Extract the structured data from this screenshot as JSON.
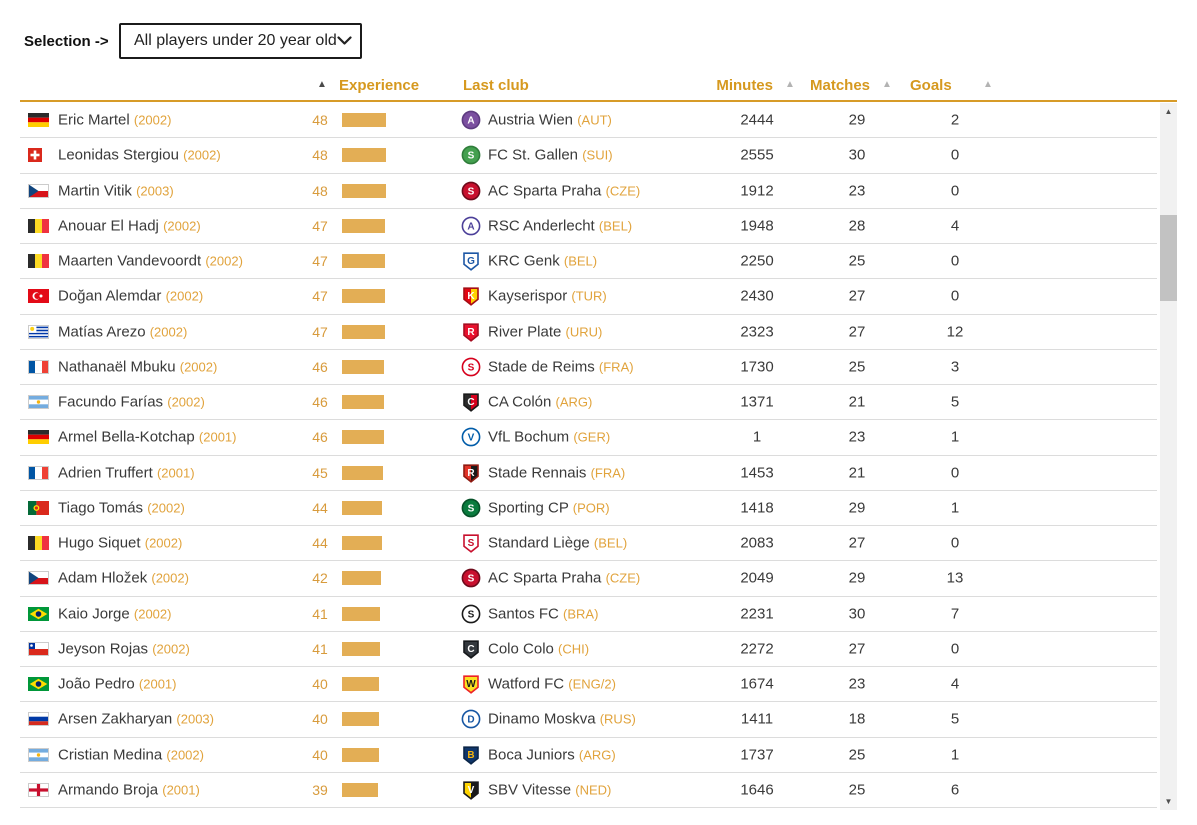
{
  "selection": {
    "label": "Selection ->",
    "value": "All players under 20 year old"
  },
  "columns": {
    "experience": "Experience",
    "last_club": "Last club",
    "minutes": "Minutes",
    "matches": "Matches",
    "goals": "Goals"
  },
  "icons": {
    "sort_asc": "▲",
    "scroll_up": "▲",
    "scroll_down": "▼"
  },
  "colors": {
    "header_gold": "#d6991f",
    "underline_gold": "#d79b28",
    "bar_gold": "#e3ae55",
    "orange_secondary": "#e1a33c",
    "dark_text": "#3a3a3a",
    "row_border": "#dcdcdc",
    "sort_arrow_grey": "#b3b3b3",
    "sort_arrow_dark": "#4a4a4a",
    "scroll_track": "#f1f1f1",
    "scroll_thumb": "#c2c2c2"
  },
  "experience_max": 48,
  "players": [
    {
      "name": "Eric Martel",
      "year": "(2002)",
      "nat": "DE",
      "exp": 48,
      "club": "Austria Wien",
      "cc": "(AUT)",
      "logo": {
        "shape": "circle",
        "c1": "#7b4fa0",
        "border": "#5d3b80",
        "letter": "A",
        "lc": "#ffffff"
      },
      "minutes": 2444,
      "matches": 29,
      "goals": 2
    },
    {
      "name": "Leonidas Stergiou",
      "year": "(2002)",
      "nat": "CH",
      "exp": 48,
      "club": "FC St. Gallen",
      "cc": "(SUI)",
      "logo": {
        "shape": "circle",
        "c1": "#44a04f",
        "border": "#2f7d3a",
        "letter": "S",
        "lc": "#ffffff"
      },
      "minutes": 2555,
      "matches": 30,
      "goals": 0
    },
    {
      "name": "Martin Vitik",
      "year": "(2003)",
      "nat": "CZ",
      "exp": 48,
      "club": "AC Sparta Praha",
      "cc": "(CZE)",
      "logo": {
        "shape": "circle",
        "c1": "#c8102e",
        "border": "#6e0a1b",
        "letter": "S",
        "lc": "#ffffff"
      },
      "minutes": 1912,
      "matches": 23,
      "goals": 0
    },
    {
      "name": "Anouar El Hadj",
      "year": "(2002)",
      "nat": "BE",
      "exp": 47,
      "club": "RSC Anderlecht",
      "cc": "(BEL)",
      "logo": {
        "shape": "circle",
        "c1": "#ffffff",
        "border": "#4b3f99",
        "letter": "A",
        "lc": "#4b3f99"
      },
      "minutes": 1948,
      "matches": 28,
      "goals": 4
    },
    {
      "name": "Maarten Vandevoordt",
      "year": "(2002)",
      "nat": "BE",
      "exp": 47,
      "club": "KRC Genk",
      "cc": "(BEL)",
      "logo": {
        "shape": "shield",
        "c1": "#ffffff",
        "border": "#1d57a5",
        "letter": "G",
        "lc": "#1d57a5"
      },
      "minutes": 2250,
      "matches": 25,
      "goals": 0
    },
    {
      "name": "Doğan Alemdar",
      "year": "(2002)",
      "nat": "TR",
      "exp": 47,
      "club": "Kayserispor",
      "cc": "(TUR)",
      "logo": {
        "shape": "shield",
        "c1": "#e30613",
        "c2": "#ffd200",
        "border": "#a50d14",
        "letter": "K",
        "lc": "#ffffff"
      },
      "minutes": 2430,
      "matches": 27,
      "goals": 0
    },
    {
      "name": "Matías Arezo",
      "year": "(2002)",
      "nat": "UY",
      "exp": 47,
      "club": "River Plate",
      "cc": "(URU)",
      "logo": {
        "shape": "shield",
        "c1": "#e8112d",
        "border": "#a50d21",
        "letter": "R",
        "lc": "#ffffff"
      },
      "minutes": 2323,
      "matches": 27,
      "goals": 12
    },
    {
      "name": "Nathanaël Mbuku",
      "year": "(2002)",
      "nat": "FR",
      "exp": 46,
      "club": "Stade de Reims",
      "cc": "(FRA)",
      "logo": {
        "shape": "circle",
        "c1": "#ffffff",
        "border": "#d6001c",
        "letter": "S",
        "lc": "#d6001c"
      },
      "minutes": 1730,
      "matches": 25,
      "goals": 3
    },
    {
      "name": "Facundo Farías",
      "year": "(2002)",
      "nat": "AR",
      "exp": 46,
      "club": "CA Colón",
      "cc": "(ARG)",
      "logo": {
        "shape": "shield",
        "c1": "#2b2b2b",
        "c2": "#d6001c",
        "border": "#1a1a1a",
        "letter": "C",
        "lc": "#ffffff"
      },
      "minutes": 1371,
      "matches": 21,
      "goals": 5
    },
    {
      "name": "Armel Bella-Kotchap",
      "year": "(2001)",
      "nat": "DE",
      "exp": 46,
      "club": "VfL Bochum",
      "cc": "(GER)",
      "logo": {
        "shape": "circle",
        "c1": "#ffffff",
        "border": "#005ca9",
        "letter": "V",
        "lc": "#005ca9"
      },
      "minutes": 1,
      "matches": 23,
      "goals": 1
    },
    {
      "name": "Adrien Truffert",
      "year": "(2001)",
      "nat": "FR",
      "exp": 45,
      "club": "Stade Rennais",
      "cc": "(FRA)",
      "logo": {
        "shape": "shield",
        "c1": "#e13327",
        "c2": "#1a1a1a",
        "border": "#8f1b12",
        "letter": "R",
        "lc": "#ffffff"
      },
      "minutes": 1453,
      "matches": 21,
      "goals": 0
    },
    {
      "name": "Tiago Tomás",
      "year": "(2002)",
      "nat": "PT",
      "exp": 44,
      "club": "Sporting CP",
      "cc": "(POR)",
      "logo": {
        "shape": "circle",
        "c1": "#0a7b3e",
        "border": "#065128",
        "letter": "S",
        "lc": "#ffffff"
      },
      "minutes": 1418,
      "matches": 29,
      "goals": 1
    },
    {
      "name": "Hugo Siquet",
      "year": "(2002)",
      "nat": "BE",
      "exp": 44,
      "club": "Standard Liège",
      "cc": "(BEL)",
      "logo": {
        "shape": "shield",
        "c1": "#ffffff",
        "border": "#c8102e",
        "letter": "S",
        "lc": "#c8102e"
      },
      "minutes": 2083,
      "matches": 27,
      "goals": 0
    },
    {
      "name": "Adam Hložek",
      "year": "(2002)",
      "nat": "CZ",
      "exp": 42,
      "club": "AC Sparta Praha",
      "cc": "(CZE)",
      "logo": {
        "shape": "circle",
        "c1": "#c8102e",
        "border": "#6e0a1b",
        "letter": "S",
        "lc": "#ffffff"
      },
      "minutes": 2049,
      "matches": 29,
      "goals": 13
    },
    {
      "name": "Kaio Jorge",
      "year": "(2002)",
      "nat": "BR",
      "exp": 41,
      "club": "Santos FC",
      "cc": "(BRA)",
      "logo": {
        "shape": "circle",
        "c1": "#ffffff",
        "border": "#1a1a1a",
        "letter": "S",
        "lc": "#1a1a1a"
      },
      "minutes": 2231,
      "matches": 30,
      "goals": 7
    },
    {
      "name": "Jeyson Rojas",
      "year": "(2002)",
      "nat": "CL",
      "exp": 41,
      "club": "Colo Colo",
      "cc": "(CHI)",
      "logo": {
        "shape": "shield",
        "c1": "#33383d",
        "border": "#15181b",
        "letter": "C",
        "lc": "#ffffff"
      },
      "minutes": 2272,
      "matches": 27,
      "goals": 0
    },
    {
      "name": "João Pedro",
      "year": "(2001)",
      "nat": "BR",
      "exp": 40,
      "club": "Watford FC",
      "cc": "(ENG/2)",
      "logo": {
        "shape": "shield",
        "c1": "#fbe122",
        "border": "#ed2127",
        "letter": "W",
        "lc": "#1a1a1a"
      },
      "minutes": 1674,
      "matches": 23,
      "goals": 4
    },
    {
      "name": "Arsen Zakharyan",
      "year": "(2003)",
      "nat": "RU",
      "exp": 40,
      "club": "Dinamo Moskva",
      "cc": "(RUS)",
      "logo": {
        "shape": "circle",
        "c1": "#ffffff",
        "border": "#1656a3",
        "letter": "D",
        "lc": "#1656a3"
      },
      "minutes": 1411,
      "matches": 18,
      "goals": 5
    },
    {
      "name": "Cristian Medina",
      "year": "(2002)",
      "nat": "AR",
      "exp": 40,
      "club": "Boca Juniors",
      "cc": "(ARG)",
      "logo": {
        "shape": "shield",
        "c1": "#10366b",
        "border": "#0a2547",
        "letter": "B",
        "lc": "#f6b40e"
      },
      "minutes": 1737,
      "matches": 25,
      "goals": 1
    },
    {
      "name": "Armando Broja",
      "year": "(2001)",
      "nat": "EN",
      "exp": 39,
      "club": "SBV Vitesse",
      "cc": "(NED)",
      "logo": {
        "shape": "shield",
        "c1": "#ffd400",
        "c2": "#1a1a1a",
        "border": "#1a1a1a",
        "letter": "V",
        "lc": "#ffffff"
      },
      "minutes": 1646,
      "matches": 25,
      "goals": 6
    }
  ]
}
